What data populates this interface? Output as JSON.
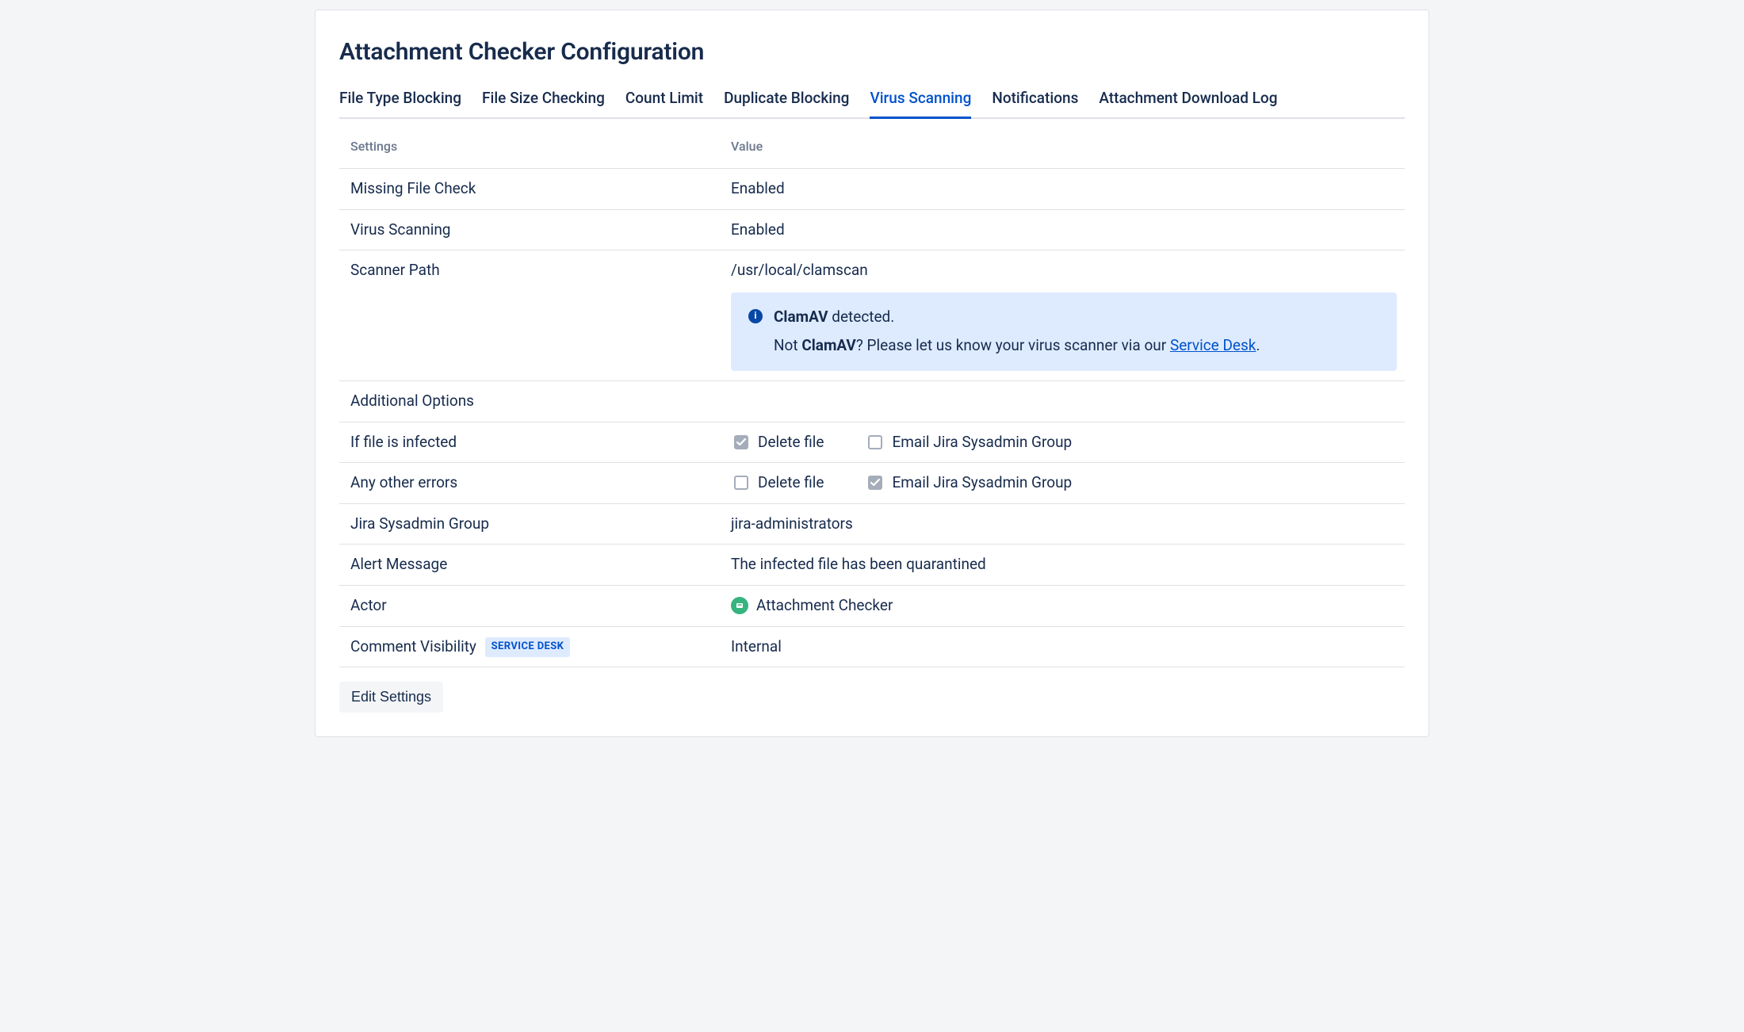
{
  "page": {
    "title": "Attachment Checker Configuration"
  },
  "tabs": [
    {
      "label": "File Type Blocking"
    },
    {
      "label": "File Size Checking"
    },
    {
      "label": "Count Limit"
    },
    {
      "label": "Duplicate Blocking"
    },
    {
      "label": "Virus Scanning"
    },
    {
      "label": "Notifications"
    },
    {
      "label": "Attachment Download Log"
    }
  ],
  "active_tab_index": 4,
  "columns": {
    "settings": "Settings",
    "value": "Value"
  },
  "rows": {
    "missing_file_check": {
      "label": "Missing File Check",
      "value": "Enabled"
    },
    "virus_scanning": {
      "label": "Virus Scanning",
      "value": "Enabled"
    },
    "scanner_path": {
      "label": "Scanner Path",
      "value": "/usr/local/clamscan"
    },
    "additional_options": {
      "label": "Additional Options"
    },
    "if_infected": {
      "label": "If file is infected"
    },
    "any_other_errors": {
      "label": "Any other errors"
    },
    "sysadmin_group": {
      "label": "Jira Sysadmin Group",
      "value": "jira-administrators"
    },
    "alert_message": {
      "label": "Alert Message",
      "value": "The infected file has been quarantined"
    },
    "actor": {
      "label": "Actor",
      "value": "Attachment Checker"
    },
    "comment_visibility": {
      "label": "Comment Visibility",
      "badge": "SERVICE DESK",
      "value": "Internal"
    }
  },
  "info_panel": {
    "line1_strong": "ClamAV",
    "line1_rest": " detected.",
    "line2_pre": "Not ",
    "line2_strong": "ClamAV",
    "line2_mid": "? Please let us know your virus scanner via our ",
    "line2_link": "Service Desk",
    "line2_post": "."
  },
  "checkbox_labels": {
    "delete_file": "Delete file",
    "email_group": "Email Jira Sysadmin Group"
  },
  "if_infected_state": {
    "delete_file": true,
    "email_group": false
  },
  "any_other_errors_state": {
    "delete_file": false,
    "email_group": true
  },
  "buttons": {
    "edit": "Edit Settings"
  }
}
